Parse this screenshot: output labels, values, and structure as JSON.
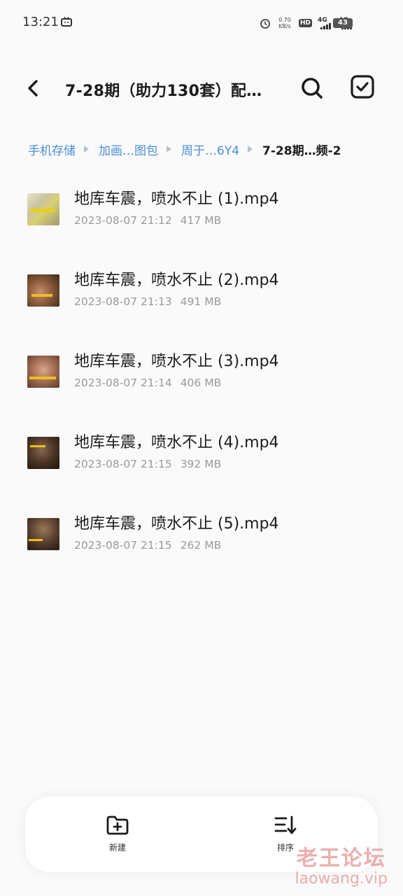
{
  "status_bar": {
    "time": "13:21",
    "speed_value": "0.70",
    "speed_unit": "KB/s",
    "hd_label": "HD",
    "network1": "4G",
    "network2": "4G",
    "battery": "43"
  },
  "header": {
    "title": "7-28期（助力130套）配…"
  },
  "breadcrumb": [
    {
      "label": "手机存储"
    },
    {
      "label": "加画…图包"
    },
    {
      "label": "周于…6Y4"
    },
    {
      "label": "7-28期…频-2"
    }
  ],
  "files": [
    {
      "name": "地库车震，喷水不止 (1).mp4",
      "date": "2023-08-07 21:12",
      "size": "417 MB"
    },
    {
      "name": "地库车震，喷水不止 (2).mp4",
      "date": "2023-08-07 21:13",
      "size": "491 MB"
    },
    {
      "name": "地库车震，喷水不止 (3).mp4",
      "date": "2023-08-07 21:14",
      "size": "406 MB"
    },
    {
      "name": "地库车震，喷水不止 (4).mp4",
      "date": "2023-08-07 21:15",
      "size": "392 MB"
    },
    {
      "name": "地库车震，喷水不止 (5).mp4",
      "date": "2023-08-07 21:15",
      "size": "262 MB"
    }
  ],
  "bottom_bar": {
    "new_label": "新建",
    "sort_label": "排序"
  },
  "watermark": {
    "cn": "老王论坛",
    "en": "laowang.vip"
  },
  "colors": {
    "breadcrumb_link": "#4a8ed8",
    "background": "#fafafa",
    "meta_text": "#9a9a9a"
  },
  "icons": [
    "back-icon",
    "search-icon",
    "select-all-icon",
    "new-folder-icon",
    "sort-icon"
  ]
}
